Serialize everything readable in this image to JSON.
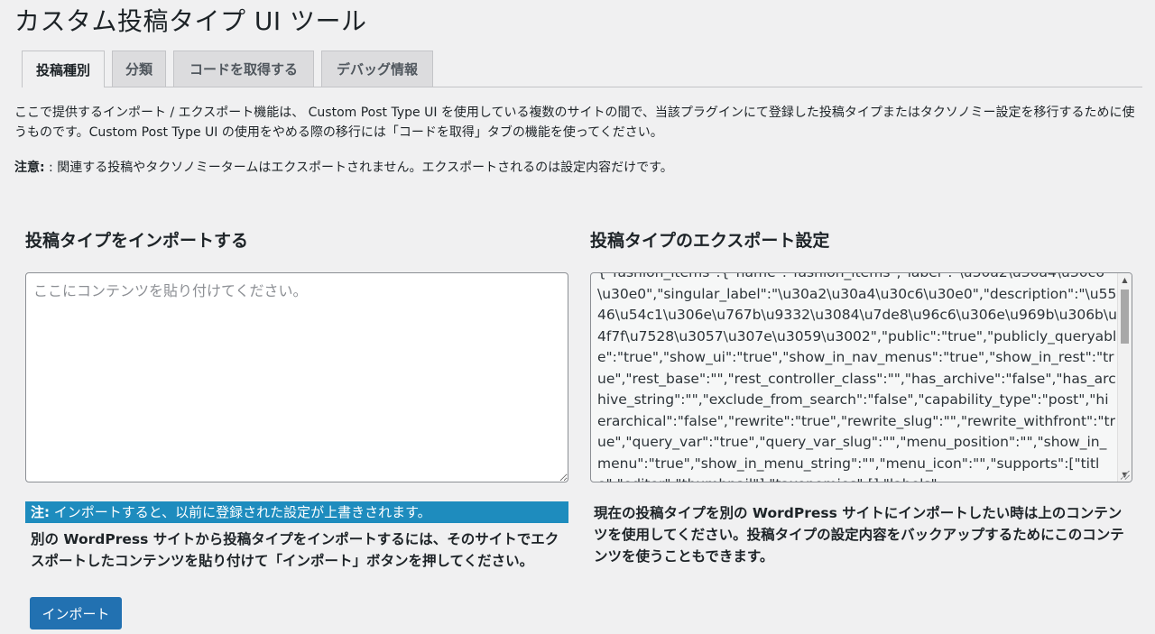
{
  "page": {
    "title": "カスタム投稿タイプ UI ツール"
  },
  "tabs": [
    {
      "label": "投稿種別",
      "active": true
    },
    {
      "label": "分類",
      "active": false
    },
    {
      "label": "コードを取得する",
      "active": false
    },
    {
      "label": "デバッグ情報",
      "active": false
    }
  ],
  "intro": {
    "text": "ここで提供するインポート / エクスポート機能は、 Custom Post Type UI を使用している複数のサイトの間で、当該プラグインにて登録した投稿タイプまたはタクソノミー設定を移行するために使うものです。Custom Post Type UI の使用をやめる際の移行には「コードを取得」タブの機能を使ってください。",
    "note_label": "注意:",
    "note_text": " : 関連する投稿やタクソノミータームはエクスポートされません。エクスポートされるのは設定内容だけです。"
  },
  "import": {
    "title": "投稿タイプをインポートする",
    "placeholder": "ここにコンテンツを貼り付けてください。",
    "warning_label": "注:",
    "warning_text": " インポートすると、以前に登録された設定が上書きされます。",
    "description": "別の WordPress サイトから投稿タイプをインポートするには、そのサイトでエクスポートしたコンテンツを貼り付けて「インポート」ボタンを押してください。",
    "button_label": "インポート"
  },
  "export": {
    "title": "投稿タイプのエクスポート設定",
    "content": "{\"fashion_items\":{\"name\":\"fashion_items\",\"label\":\"\\u30a2\\u30a4\\u30c6\\u30e0\",\"singular_label\":\"\\u30a2\\u30a4\\u30c6\\u30e0\",\"description\":\"\\u5546\\u54c1\\u306e\\u767b\\u9332\\u3084\\u7de8\\u96c6\\u306e\\u969b\\u306b\\u4f7f\\u7528\\u3057\\u307e\\u3059\\u3002\",\"public\":\"true\",\"publicly_queryable\":\"true\",\"show_ui\":\"true\",\"show_in_nav_menus\":\"true\",\"show_in_rest\":\"true\",\"rest_base\":\"\",\"rest_controller_class\":\"\",\"has_archive\":\"false\",\"has_archive_string\":\"\",\"exclude_from_search\":\"false\",\"capability_type\":\"post\",\"hierarchical\":\"false\",\"rewrite\":\"true\",\"rewrite_slug\":\"\",\"rewrite_withfront\":\"true\",\"query_var\":\"true\",\"query_var_slug\":\"\",\"menu_position\":\"\",\"show_in_menu\":\"true\",\"show_in_menu_string\":\"\",\"menu_icon\":\"\",\"supports\":[\"title\",\"editor\",\"thumbnail\"],\"taxonomies\":[],\"labels\":",
    "description": "現在の投稿タイプを別の WordPress サイトにインポートしたい時は上のコンテンツを使用してください。投稿タイプの設定内容をバックアップするためにこのコンテンツを使うこともできます。"
  },
  "colors": {
    "accent": "#2271b1",
    "warning_bg": "#1e8cbe",
    "background": "#f0f0f1"
  }
}
